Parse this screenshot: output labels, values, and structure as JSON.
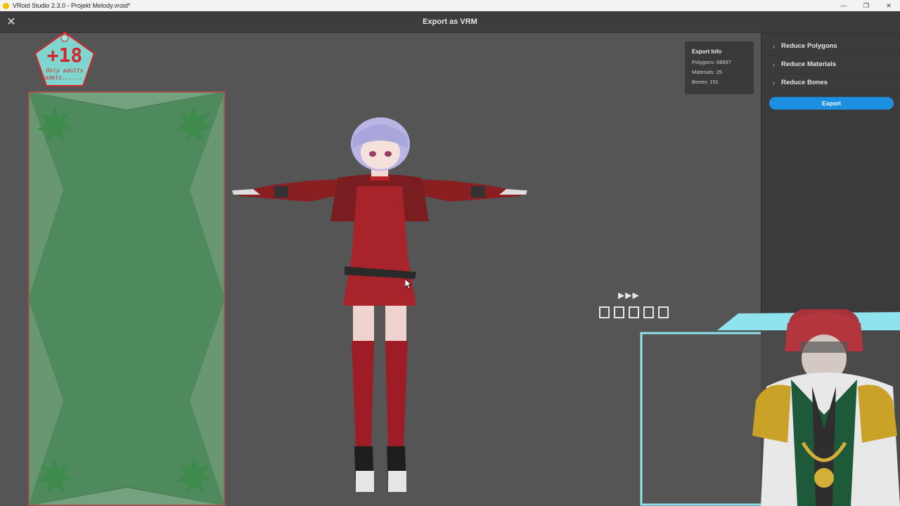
{
  "window": {
    "title": "VRoid Studio 2.3.0 - Projekt Melody.vroid*",
    "controls": [
      "—",
      "❐",
      "✕"
    ]
  },
  "header": {
    "close_icon": "✕",
    "title": "Export as VRM"
  },
  "export_info": {
    "title": "Export Info",
    "polygons": "Polygons: 68897",
    "materials": "Materials: 25",
    "bones": "Bones: 191"
  },
  "panel": {
    "items": [
      {
        "label": "Reduce Polygons"
      },
      {
        "label": "Reduce Materials"
      },
      {
        "label": "Reduce Bones"
      }
    ],
    "export_label": "Export"
  },
  "overlay": {
    "badge_number": "+18",
    "badge_line1": "Only adults",
    "badge_line2": "Cadets......",
    "arrows": "▶▶▶"
  },
  "colors": {
    "accent": "#1c8fe0",
    "badge_bg": "#7ed6cf",
    "badge_text": "#d2262a",
    "card_green": "#4a7d57",
    "frame_cyan": "#8fe3ee"
  }
}
